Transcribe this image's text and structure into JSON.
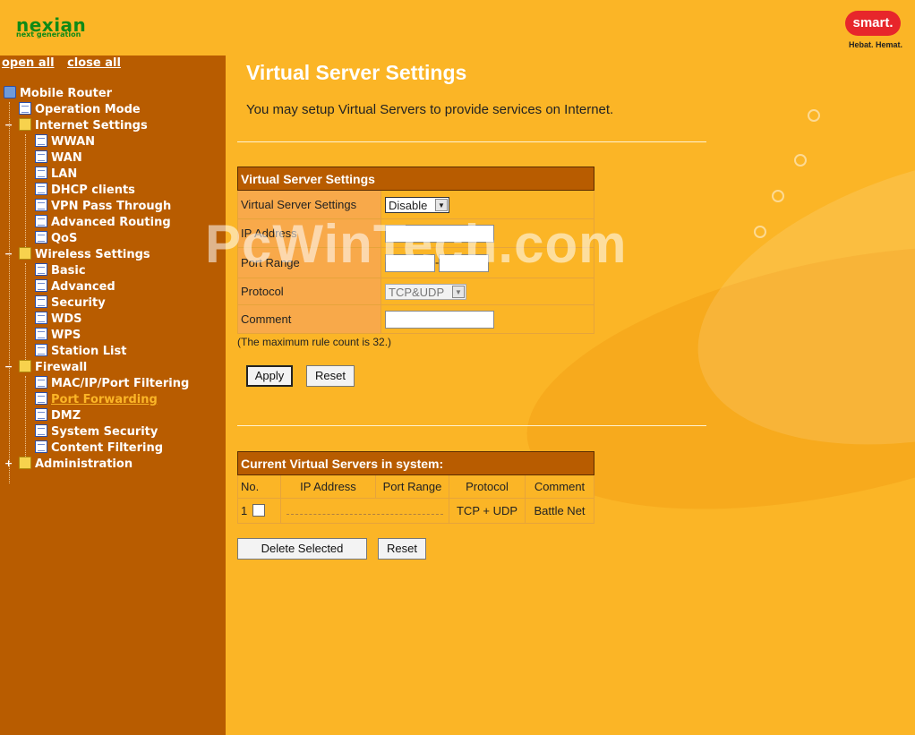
{
  "brand": {
    "logo": "nexian",
    "logo_tagline": "next generation",
    "partner_logo": "smart.",
    "partner_tagline": "Hebat. Hemat."
  },
  "sidebar": {
    "open_all": "open all",
    "close_all": "close all",
    "root": "Mobile Router",
    "operation_mode": "Operation Mode",
    "internet_settings": {
      "label": "Internet Settings",
      "items": [
        "WWAN",
        "WAN",
        "LAN",
        "DHCP clients",
        "VPN Pass Through",
        "Advanced Routing",
        "QoS"
      ]
    },
    "wireless_settings": {
      "label": "Wireless Settings",
      "items": [
        "Basic",
        "Advanced",
        "Security",
        "WDS",
        "WPS",
        "Station List"
      ]
    },
    "firewall": {
      "label": "Firewall",
      "items": [
        "MAC/IP/Port Filtering",
        "Port Forwarding",
        "DMZ",
        "System Security",
        "Content Filtering"
      ],
      "active": "Port Forwarding"
    },
    "administration": "Administration"
  },
  "main": {
    "title": "Virtual Server Settings",
    "intro": "You may setup Virtual Servers to provide services on Internet.",
    "form": {
      "header": "Virtual Server Settings",
      "vs_label": "Virtual Server Settings",
      "vs_value": "Disable",
      "ip_label": "IP Address",
      "ip_value": "",
      "port_range_label": "Port Range",
      "port_from": "",
      "port_sep": "-",
      "port_to": "",
      "protocol_label": "Protocol",
      "protocol_value": "TCP&UDP",
      "comment_label": "Comment",
      "comment_value": ""
    },
    "note": "(The maximum rule count is 32.)",
    "apply": "Apply",
    "reset": "Reset",
    "current": {
      "header": "Current Virtual Servers in system:",
      "columns": [
        "No.",
        "IP Address",
        "Port Range",
        "Protocol",
        "Comment"
      ],
      "rows": [
        {
          "no": "1",
          "protocol": "TCP + UDP",
          "comment": "Battle Net"
        }
      ]
    },
    "delete_selected": "Delete Selected",
    "reset2": "Reset"
  },
  "watermark": "PcWinTech.com",
  "colors": {
    "background": "#fbb526",
    "sidebar": "#b85c00",
    "header_bar": "#b85c00",
    "label_cell": "#f8a94a",
    "brand_green": "#0f8a16",
    "smart_red": "#e7262b"
  }
}
